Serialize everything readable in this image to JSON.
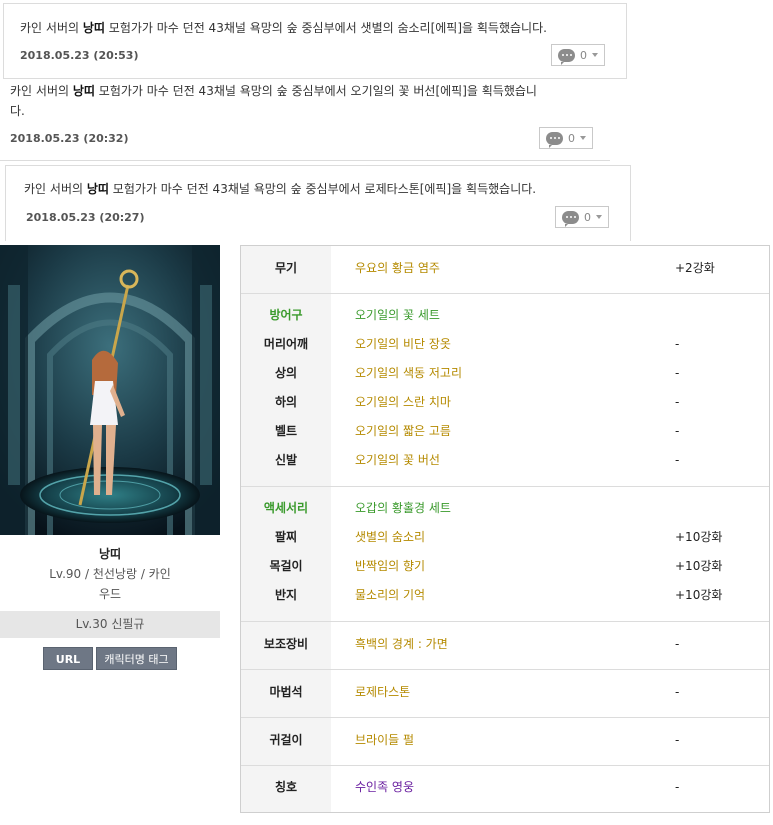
{
  "feed": [
    {
      "server": "카인",
      "prefix": "서버의",
      "name": "낭띠",
      "body": "모험가가 마수 던전 43채널 욕망의 숲 중심부에서 샛별의 숨소리[에픽]을 획득했습니다.",
      "date": "2018.05.23 (20:53)",
      "comments": "0"
    },
    {
      "server": "카인",
      "prefix": "서버의",
      "name": "낭띠",
      "body": "모험가가 마수 던전 43채널 욕망의 숲 중심부에서 오기일의 꽃 버선[에픽]을 획득했습니",
      "body2": "다.",
      "date": "2018.05.23 (20:32)",
      "comments": "0"
    },
    {
      "server": "카인",
      "prefix": "서버의",
      "name": "낭띠",
      "body": "모험가가 마수 던전 43채널 욕망의 숲 중심부에서 로제타스톤[에픽]을 획득했습니다.",
      "date": "2018.05.23 (20:27)",
      "comments": "0"
    }
  ],
  "character": {
    "name": "낭띠",
    "line1": "Lv.90 / 천선낭랑 / 카인",
    "line2": "우드",
    "guild": "Lv.30 신필규",
    "url_button": "URL",
    "tag_button": "캐릭터명 태그"
  },
  "equipment": {
    "weapon": {
      "label": "무기",
      "item": "우요의 황금 염주",
      "enh": "+2강화"
    },
    "armor_title": {
      "label": "방어구",
      "item": "오기일의 꽃 세트"
    },
    "shoulder": {
      "label": "머리어깨",
      "item": "오기일의 비단 장옷",
      "enh": "-"
    },
    "top": {
      "label": "상의",
      "item": "오기일의 색동 저고리",
      "enh": "-"
    },
    "bottom": {
      "label": "하의",
      "item": "오기일의 스란 치마",
      "enh": "-"
    },
    "belt": {
      "label": "벨트",
      "item": "오기일의 짧은 고름",
      "enh": "-"
    },
    "shoes": {
      "label": "신발",
      "item": "오기일의 꽃 버선",
      "enh": "-"
    },
    "acc_title": {
      "label": "액세서리",
      "item": "오갑의 황홀경 세트"
    },
    "bracelet": {
      "label": "팔찌",
      "item": "샛별의 숨소리",
      "enh": "+10강화"
    },
    "necklace": {
      "label": "목걸이",
      "item": "반짝임의 향기",
      "enh": "+10강화"
    },
    "ring": {
      "label": "반지",
      "item": "물소리의 기억",
      "enh": "+10강화"
    },
    "support": {
      "label": "보조장비",
      "item": "흑백의 경계 : 가면",
      "enh": "-"
    },
    "magicstone": {
      "label": "마법석",
      "item": "로제타스톤",
      "enh": "-"
    },
    "earring": {
      "label": "귀걸이",
      "item": "브라이들 펄",
      "enh": "-"
    },
    "title": {
      "label": "칭호",
      "item": "수인족 영웅",
      "enh": "-"
    }
  },
  "colors": {
    "epic_gold": "#b58a00",
    "set_green": "#3a9a2c",
    "title_purple": "#6a1fa0",
    "button_gray": "#6e7785"
  }
}
